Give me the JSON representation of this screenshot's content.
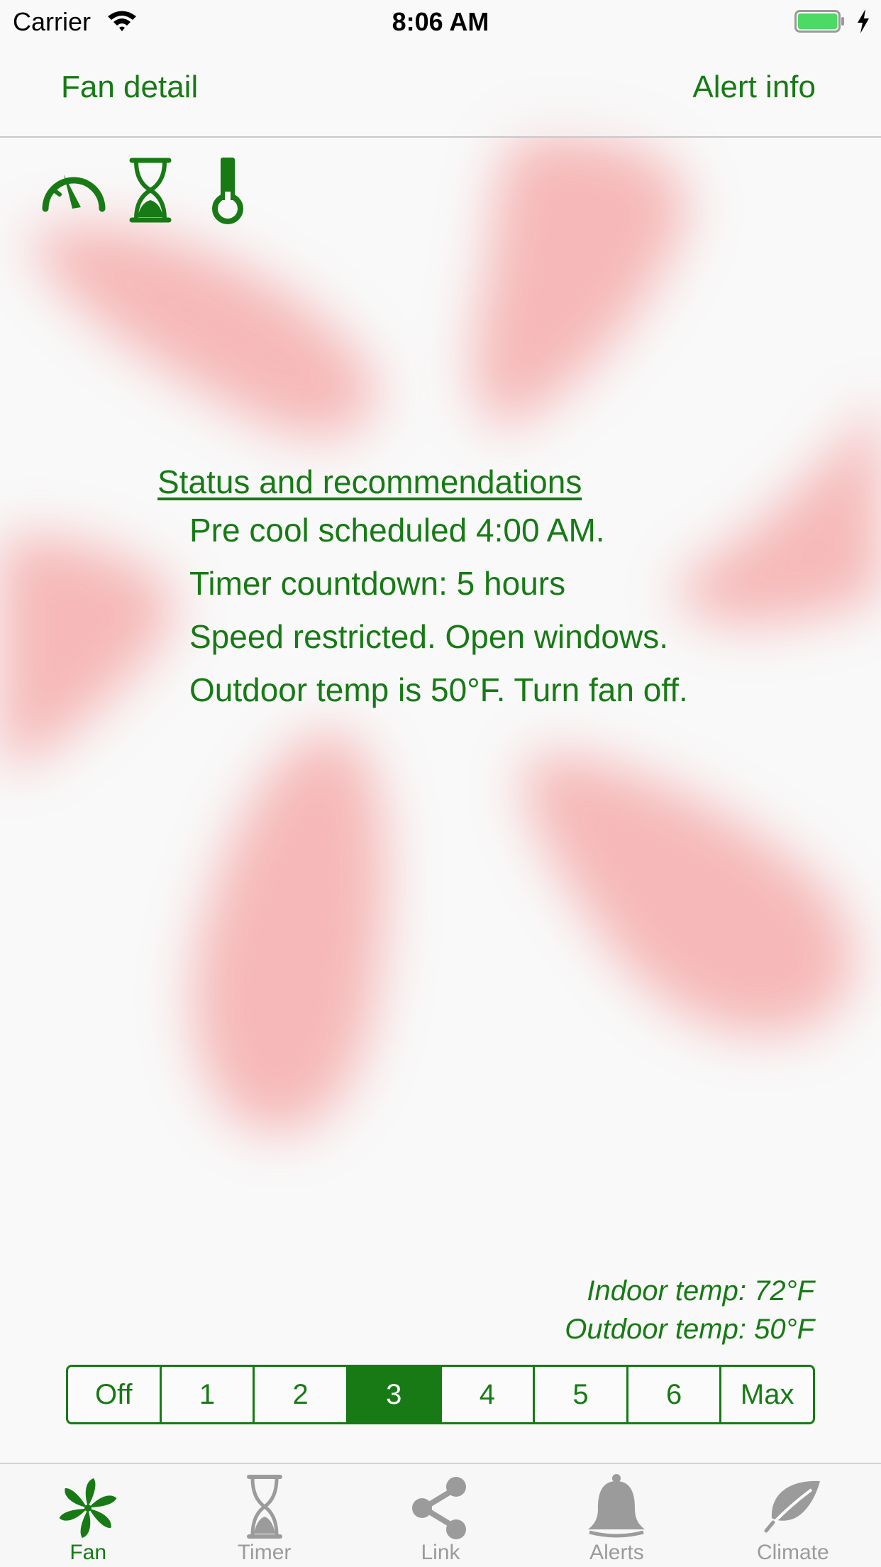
{
  "status_bar": {
    "carrier": "Carrier",
    "time": "8:06 AM"
  },
  "nav": {
    "left": "Fan detail",
    "right": "Alert info"
  },
  "indicators": [
    {
      "icon": "speedometer-icon"
    },
    {
      "icon": "hourglass-icon"
    },
    {
      "icon": "thermometer-icon"
    }
  ],
  "status": {
    "title": "Status and recommendations",
    "lines": [
      "Pre cool scheduled 4:00 AM.",
      "Timer countdown: 5 hours",
      "Speed restricted. Open windows.",
      "Outdoor temp is 50°F. Turn fan off."
    ]
  },
  "temps": {
    "indoor": "Indoor temp: 72°F",
    "outdoor": "Outdoor temp: 50°F"
  },
  "speed": {
    "options": [
      "Off",
      "1",
      "2",
      "3",
      "4",
      "5",
      "6",
      "Max"
    ],
    "selected": "3"
  },
  "tabs": [
    {
      "label": "Fan",
      "icon": "fan-icon",
      "active": true
    },
    {
      "label": "Timer",
      "icon": "hourglass-icon",
      "active": false
    },
    {
      "label": "Link",
      "icon": "share-icon",
      "active": false
    },
    {
      "label": "Alerts",
      "icon": "bell-icon",
      "active": false
    },
    {
      "label": "Climate",
      "icon": "leaf-icon",
      "active": false
    }
  ],
  "colors": {
    "accent": "#177a15",
    "fan_blades": "#f5a3a3",
    "inactive_tab": "#9b9b9b",
    "background": "#f9f9f9"
  }
}
